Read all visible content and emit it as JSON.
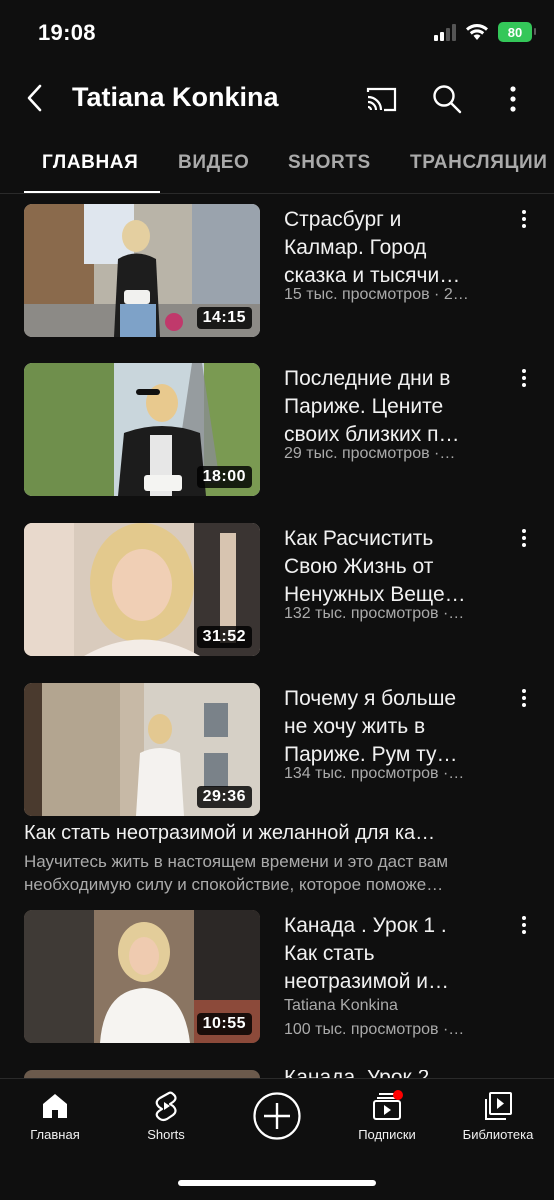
{
  "status_bar": {
    "time": "19:08",
    "battery": "80"
  },
  "header": {
    "channel_name": "Tatiana Konkina"
  },
  "tabs": [
    {
      "label": "ГЛАВНАЯ",
      "active": true
    },
    {
      "label": "ВИДЕО",
      "active": false
    },
    {
      "label": "SHORTS",
      "active": false
    },
    {
      "label": "ТРАНСЛЯЦИИ",
      "active": false
    }
  ],
  "videos": [
    {
      "title_lines": [
        "Страсбург и",
        "Калмар. Город",
        "сказка и тысячи…"
      ],
      "meta": "15 тыс. просмотров · 2…",
      "duration": "14:15"
    },
    {
      "title_lines": [
        "Последние дни в",
        "Париже. Цените",
        "своих близких п…"
      ],
      "meta": "29 тыс. просмотров ·…",
      "duration": "18:00"
    },
    {
      "title_lines": [
        "Как  Расчистить",
        "Свою Жизнь от",
        "Ненужных Веще…"
      ],
      "meta": "132 тыс. просмотров ·…",
      "duration": "31:52"
    },
    {
      "title_lines": [
        "Почему я больше",
        "не хочу жить в",
        "Париже. Рум ту…"
      ],
      "meta": "134 тыс. просмотров ·…",
      "duration": "29:36"
    }
  ],
  "playlist": {
    "title": "Как стать неотразимой и желанной для ка…",
    "description_lines": [
      "Научитесь жить в настоящем времени и это даст вам",
      "необходимую силу и спокойствие, которое поможе…"
    ],
    "video": {
      "title_lines": [
        "Канада . Урок 1 .",
        "Как стать",
        "неотразимой и…"
      ],
      "channel": "Tatiana Konkina",
      "meta": "100 тыс. просмотров ·…",
      "duration": "10:55"
    },
    "next_partial_title": "Канада. Урок 2"
  },
  "bottom_nav": {
    "home": "Главная",
    "shorts": "Shorts",
    "subscriptions": "Подписки",
    "library": "Библиотека"
  },
  "colors": {
    "background": "#0f0f0f",
    "text_primary": "#f1f1f1",
    "text_secondary": "#aaaaaa",
    "battery": "#34c759",
    "notification_dot": "#ff0000"
  },
  "icons": [
    "back-arrow-icon",
    "cast-icon",
    "search-icon",
    "more-vert-icon",
    "home-icon",
    "shorts-icon",
    "create-plus-icon",
    "subscriptions-icon",
    "library-icon"
  ]
}
